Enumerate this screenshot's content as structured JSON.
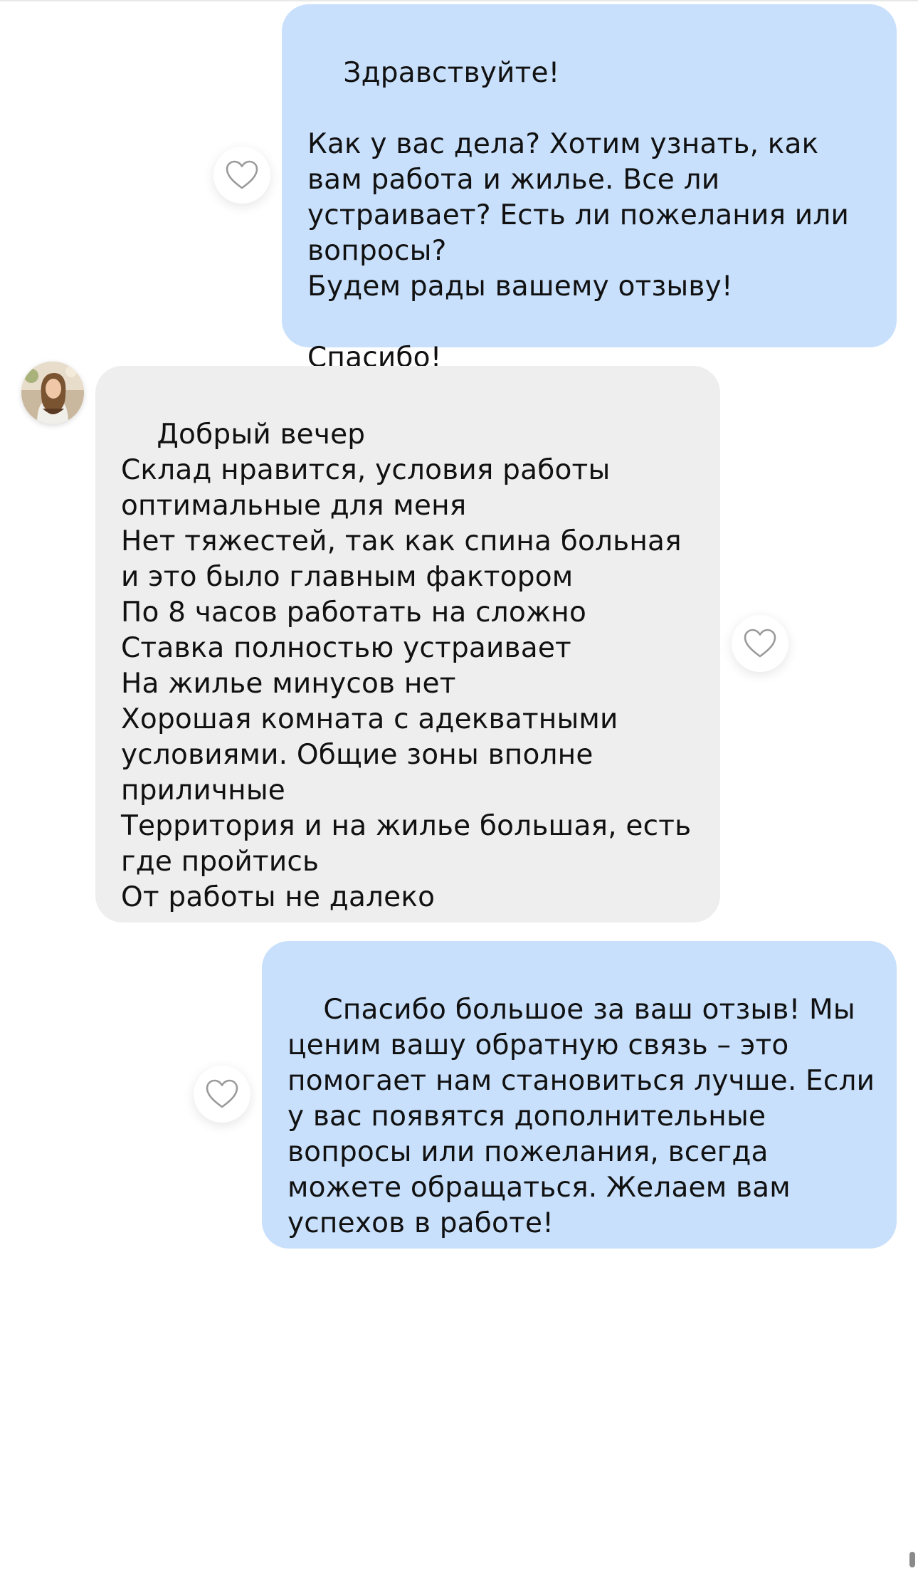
{
  "messages": [
    {
      "direction": "outgoing",
      "text": "Здравствуйте!\n\nКак у вас дела? Хотим узнать, как вам работа и жилье. Все ли устраивает? Есть ли пожелания или вопросы?\nБудем рады вашему отзыву!\n\nСпасибо!",
      "liked": false
    },
    {
      "direction": "incoming",
      "text": "Добрый вечер\nСклад нравится, условия работы оптимальные для меня\nНет тяжестей, так как спина больная и это было главным фактором\nПо 8 часов работать на сложно\nСтавка полностью устраивает\nНа жилье минусов нет\nХорошая комната с адекватными условиями. Общие зоны вполне приличные\nТерритория и на жилье большая, есть где пройтись\nОт работы не далеко",
      "liked": false
    },
    {
      "direction": "outgoing",
      "text": "Спасибо большое за ваш отзыв! Мы ценим вашу обратную связь – это помогает нам становиться лучше. Если у вас появятся дополнительные вопросы или пожелания, всегда можете обращаться. Желаем вам успехов в работе!",
      "liked": false
    }
  ],
  "icons": {
    "like": "heart-outline-icon",
    "avatar": "user-avatar-photo"
  },
  "colors": {
    "outgoing_bubble": "#c8e0fc",
    "incoming_bubble": "#eeeeee",
    "heart_stroke": "#9a9a9a"
  }
}
